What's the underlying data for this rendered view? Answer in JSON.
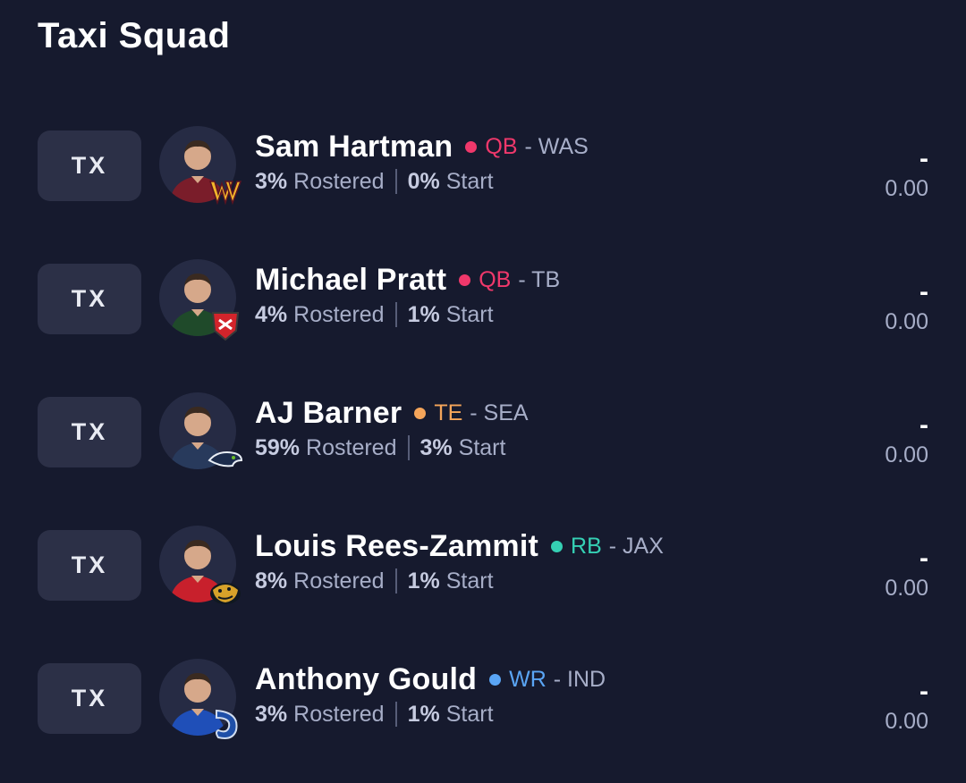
{
  "page": {
    "title": "Taxi Squad"
  },
  "players": [
    {
      "slot": "TX",
      "name": "Sam Hartman",
      "position": "QB",
      "team": "- WAS",
      "pos_color": "#f0386b",
      "rostered_pct": "3%",
      "rostered_label": "Rostered",
      "start_pct": "0%",
      "start_label": "Start",
      "projection": "-",
      "points": "0.00",
      "jersey_color": "#7a1d2a",
      "logo_icon": "commanders-logo-icon"
    },
    {
      "slot": "TX",
      "name": "Michael Pratt",
      "position": "QB",
      "team": "- TB",
      "pos_color": "#f0386b",
      "rostered_pct": "4%",
      "rostered_label": "Rostered",
      "start_pct": "1%",
      "start_label": "Start",
      "projection": "-",
      "points": "0.00",
      "jersey_color": "#1f4a2a",
      "logo_icon": "buccaneers-logo-icon"
    },
    {
      "slot": "TX",
      "name": "AJ Barner",
      "position": "TE",
      "team": "- SEA",
      "pos_color": "#f5a55a",
      "rostered_pct": "59%",
      "rostered_label": "Rostered",
      "start_pct": "3%",
      "start_label": "Start",
      "projection": "-",
      "points": "0.00",
      "jersey_color": "#283a5c",
      "logo_icon": "seahawks-logo-icon"
    },
    {
      "slot": "TX",
      "name": "Louis Rees-Zammit",
      "position": "RB",
      "team": "- JAX",
      "pos_color": "#35d0b4",
      "rostered_pct": "8%",
      "rostered_label": "Rostered",
      "start_pct": "1%",
      "start_label": "Start",
      "projection": "-",
      "points": "0.00",
      "jersey_color": "#c8202c",
      "logo_icon": "jaguars-logo-icon"
    },
    {
      "slot": "TX",
      "name": "Anthony Gould",
      "position": "WR",
      "team": "- IND",
      "pos_color": "#5aa5f5",
      "rostered_pct": "3%",
      "rostered_label": "Rostered",
      "start_pct": "1%",
      "start_label": "Start",
      "projection": "-",
      "points": "0.00",
      "jersey_color": "#1f4fb8",
      "logo_icon": "colts-logo-icon"
    }
  ]
}
